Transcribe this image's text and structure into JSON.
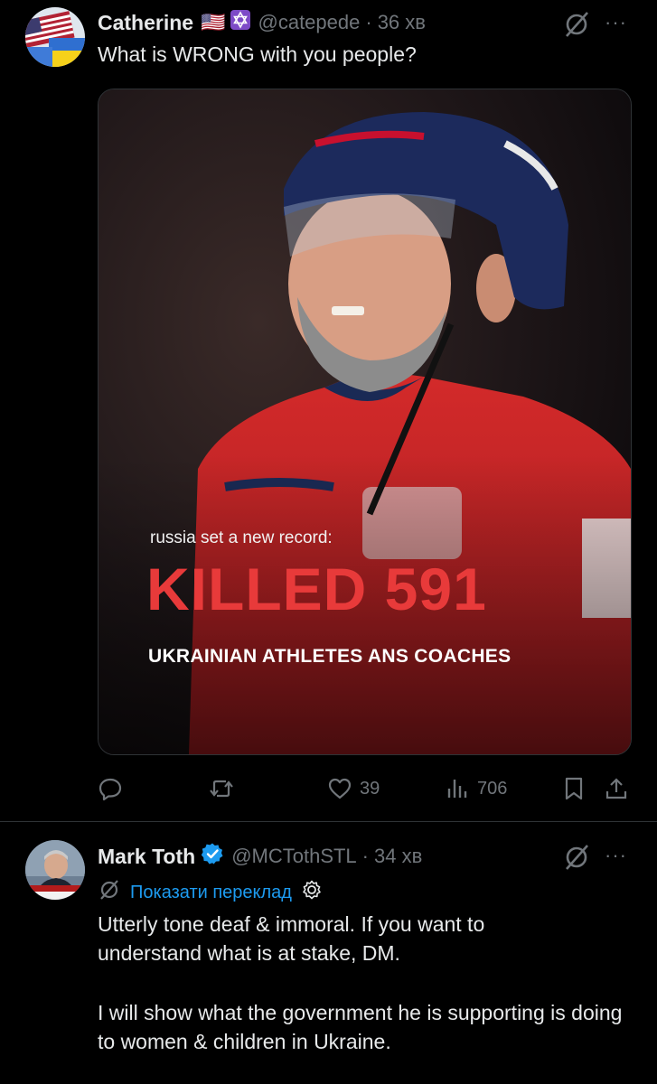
{
  "tweet1": {
    "author_name": "Catherine",
    "handle": "@catepede",
    "time": "36 хв",
    "separator": "·",
    "text": "What is WRONG with you people?",
    "flag_emoji": "🇺🇸",
    "star_emoji": "✡️",
    "more_label": "···",
    "media": {
      "subtitle": "russia set a new record:",
      "headline": "KILLED 591",
      "caption": "UKRAINIAN ATHLETES ANS COACHES"
    },
    "actions": {
      "reply_count": "",
      "retweet_count": "",
      "like_count": "39",
      "views_count": "706"
    }
  },
  "tweet2": {
    "author_name": "Mark Toth",
    "handle": "@MCTothSTL",
    "time": "34 хв",
    "separator": "·",
    "more_label": "···",
    "translate_label": "Показати переклад",
    "text_p1": "Utterly tone deaf & immoral. If you want to understand what is at stake, DM.",
    "text_p2": "I will show what the government he is supporting is doing to women & children in Ukraine."
  },
  "colors": {
    "background": "#000000",
    "text": "#e7e9ea",
    "muted": "#71767b",
    "accent": "#1d9bf0",
    "headline_red": "#e83a3a"
  },
  "icons": [
    "grok-icon",
    "more-icon",
    "reply-icon",
    "retweet-icon",
    "like-icon",
    "views-icon",
    "bookmark-icon",
    "share-icon",
    "verified-icon",
    "gear-icon"
  ]
}
